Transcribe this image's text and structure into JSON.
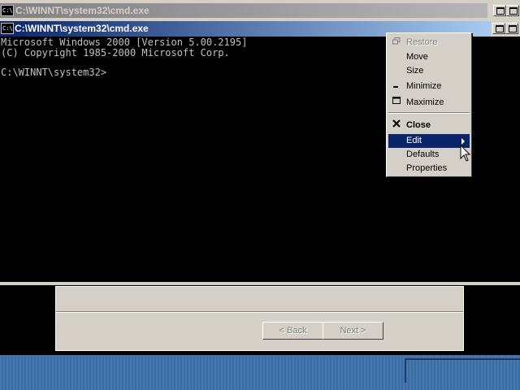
{
  "background_window": {
    "title": "C:\\WINNT\\system32\\cmd.exe",
    "icon": "cmd-icon"
  },
  "active_window": {
    "title": "C:\\WINNT\\system32\\cmd.exe",
    "icon": "cmd-icon"
  },
  "console": {
    "lines": [
      "Microsoft Windows 2000 [Version 5.00.2195]",
      "(C) Copyright 1985-2000 Microsoft Corp.",
      "",
      "C:\\WINNT\\system32>"
    ]
  },
  "system_menu": {
    "items": [
      {
        "label": "Restore",
        "icon": "restore-icon",
        "state": "disabled"
      },
      {
        "label": "Move",
        "icon": "",
        "state": "normal"
      },
      {
        "label": "Size",
        "icon": "",
        "state": "normal"
      },
      {
        "label": "Minimize",
        "icon": "minimize-icon",
        "state": "normal"
      },
      {
        "label": "Maximize",
        "icon": "maximize-icon",
        "state": "normal"
      },
      {
        "label": "Close",
        "icon": "close-icon",
        "state": "bold"
      },
      {
        "label": "Edit",
        "icon": "",
        "state": "highlight",
        "submenu": true
      },
      {
        "label": "Defaults",
        "icon": "",
        "state": "normal"
      },
      {
        "label": "Properties",
        "icon": "",
        "state": "normal"
      }
    ]
  },
  "wizard": {
    "back_label": "< Back",
    "next_label": "Next >"
  },
  "colors": {
    "title_active": "#0a246a",
    "title_inactive": "#808080",
    "face": "#d4d0c8",
    "desktop": "#3a6ea5"
  }
}
